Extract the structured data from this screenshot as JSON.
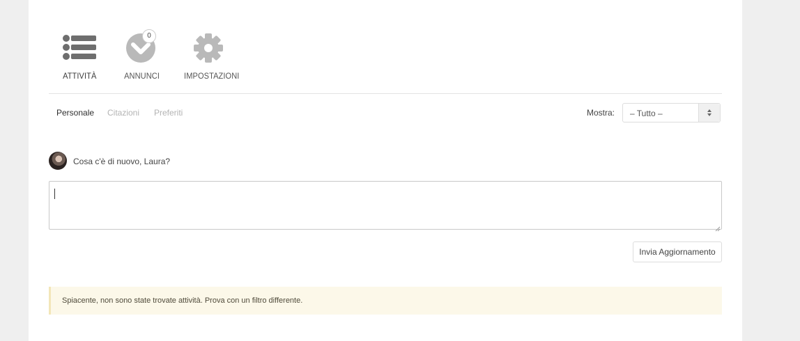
{
  "nav": {
    "items": [
      {
        "label": "ATTIVITÀ",
        "icon": "list-icon"
      },
      {
        "label": "ANNUNCI",
        "icon": "chevron-down-circle-icon",
        "badge": "0"
      },
      {
        "label": "IMPOSTAZIONI",
        "icon": "gear-icon"
      }
    ]
  },
  "subtabs": [
    {
      "label": "Personale",
      "active": true
    },
    {
      "label": "Citazioni",
      "active": false
    },
    {
      "label": "Preferiti",
      "active": false
    }
  ],
  "filter": {
    "label": "Mostra:",
    "selected": "– Tutto –"
  },
  "composer": {
    "prompt": "Cosa c'è di nuovo, Laura?",
    "value": "",
    "submit_label": "Invia Aggiornamento"
  },
  "notice": {
    "text": "Spiacente, non sono state trovate attività. Prova con un filtro differente."
  },
  "colors": {
    "page_bg": "#efefef",
    "panel_bg": "#ffffff",
    "icon_gray": "#6e6e6e",
    "icon_light": "#b9b9b9",
    "notice_bg": "#fcf8e9"
  }
}
